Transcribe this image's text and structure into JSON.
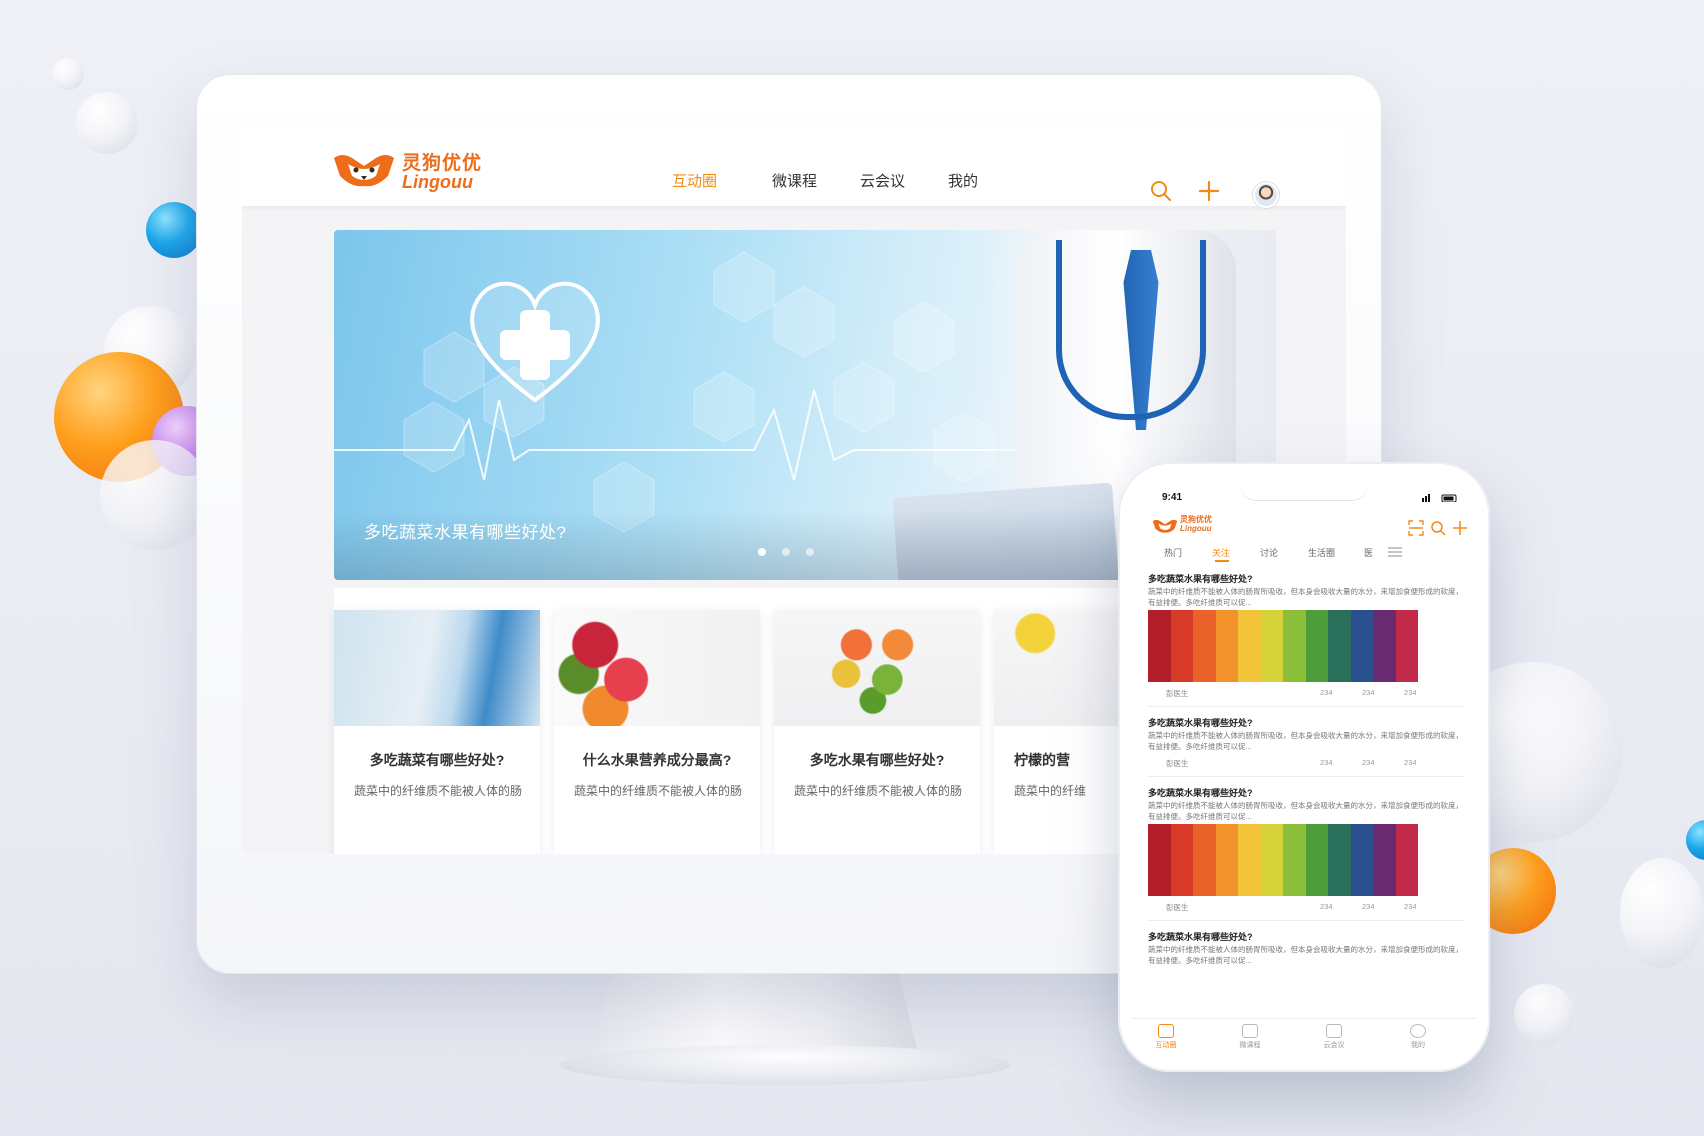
{
  "brand": {
    "name_cn": "灵狗优优",
    "name_en": "Lingouu",
    "accent": "#f28a16",
    "logo_color": "#ef6c1a"
  },
  "desktop": {
    "nav": [
      {
        "label": "互动圈",
        "active": true
      },
      {
        "label": "微课程",
        "active": false
      },
      {
        "label": "云会议",
        "active": false
      },
      {
        "label": "我的",
        "active": false
      }
    ],
    "header_icons": [
      "search-icon",
      "plus-icon",
      "avatar"
    ],
    "banner": {
      "caption": "多吃蔬菜水果有哪些好处?",
      "slides": 3,
      "active_slide": 1
    },
    "cards": [
      {
        "title": "多吃蔬菜有哪些好处?",
        "excerpt": "蔬菜中的纤维质不能被人体的肠"
      },
      {
        "title": "什么水果营养成分最高?",
        "excerpt": "蔬菜中的纤维质不能被人体的肠"
      },
      {
        "title": "多吃水果有哪些好处?",
        "excerpt": "蔬菜中的纤维质不能被人体的肠"
      },
      {
        "title": "柠檬的营",
        "excerpt": "蔬菜中的纤维"
      }
    ]
  },
  "mobile": {
    "status_time": "9:41",
    "tabs": [
      {
        "label": "热门",
        "active": false
      },
      {
        "label": "关注",
        "active": true
      },
      {
        "label": "讨论",
        "active": false
      },
      {
        "label": "生活圈",
        "active": false
      },
      {
        "label": "医",
        "active": false
      }
    ],
    "posts": [
      {
        "title": "多吃蔬菜水果有哪些好处?",
        "text": "蔬菜中的纤维质不能被人体的肠胃所吸收，但本身会吸收大量的水分，来增加食便形成的软度，有益排便。多吃纤维质可以促...",
        "author": "彭医生",
        "views": "234",
        "comments": "234",
        "likes": "234",
        "has_image": true
      },
      {
        "title": "多吃蔬菜水果有哪些好处?",
        "text": "蔬菜中的纤维质不能被人体的肠胃所吸收，但本身会吸收大量的水分，来增加食便形成的软度，有益排便。多吃纤维质可以促...",
        "author": "彭医生",
        "views": "234",
        "comments": "234",
        "likes": "234",
        "has_image": false
      },
      {
        "title": "多吃蔬菜水果有哪些好处?",
        "text": "蔬菜中的纤维质不能被人体的肠胃所吸收，但本身会吸收大量的水分，来增加食便形成的软度，有益排便。多吃纤维质可以促...",
        "author": "彭医生",
        "views": "234",
        "comments": "234",
        "likes": "234",
        "has_image": true
      },
      {
        "title": "多吃蔬菜水果有哪些好处?",
        "text": "蔬菜中的纤维质不能被人体的肠胃所吸收，但本身会吸收大量的水分，来增加食便形成的软度，有益排便。多吃纤维质可以促...",
        "author": "",
        "views": "",
        "comments": "",
        "likes": "",
        "has_image": false
      }
    ],
    "tabbar": [
      {
        "label": "互动圈",
        "active": true
      },
      {
        "label": "微课程",
        "active": false
      },
      {
        "label": "云会议",
        "active": false
      },
      {
        "label": "我的",
        "active": false
      }
    ]
  }
}
